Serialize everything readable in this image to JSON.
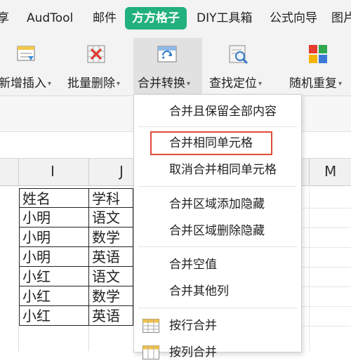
{
  "ribbon": {
    "tabs": [
      "享",
      "AudTool",
      "邮件",
      "方方格子",
      "DIY工具箱",
      "公式向导",
      "图片"
    ],
    "active_tab": "方方格子",
    "accent": "#22b07d"
  },
  "toolbar": {
    "items": [
      {
        "label": "新增插入",
        "icon": "insert-icon"
      },
      {
        "label": "批量删除",
        "icon": "delete-icon"
      },
      {
        "label": "合并转换",
        "icon": "merge-convert-icon"
      },
      {
        "label": "查找定位",
        "icon": "find-icon"
      },
      {
        "label": "随机重复",
        "icon": "random-icon"
      }
    ]
  },
  "sheet": {
    "columns": [
      "I",
      "J",
      "M"
    ],
    "rows": [
      [
        "姓名",
        "学科"
      ],
      [
        "小明",
        "语文"
      ],
      [
        "小明",
        "数学"
      ],
      [
        "小明",
        "英语"
      ],
      [
        "小红",
        "语文"
      ],
      [
        "小红",
        "数学"
      ],
      [
        "小红",
        "英语"
      ]
    ]
  },
  "menu": {
    "items": [
      {
        "label": "合并且保留全部内容"
      },
      {
        "label": "合并相同单元格",
        "highlighted": true
      },
      {
        "label": "取消合并相同单元格"
      },
      {
        "label": "合并区域添加隐藏"
      },
      {
        "label": "合并区域删除隐藏"
      },
      {
        "label": "合并空值"
      },
      {
        "label": "合并其他列"
      },
      {
        "label": "按行合并",
        "icon": "table-grid-icon"
      },
      {
        "label": "按列合并",
        "icon": "table-grid-icon"
      }
    ],
    "highlight_color": "#e14b3b"
  }
}
